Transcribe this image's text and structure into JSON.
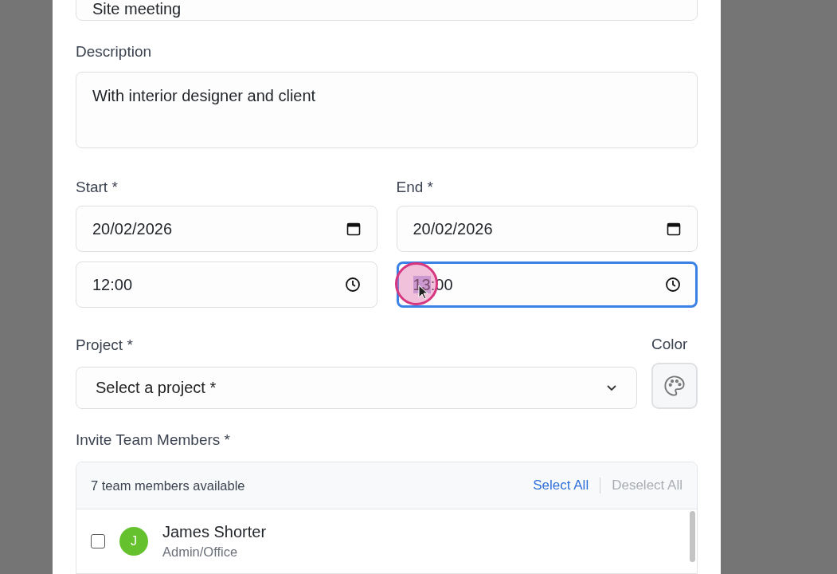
{
  "title_field": {
    "value": "Site meeting"
  },
  "description": {
    "label": "Description",
    "value": "With interior designer and client"
  },
  "start": {
    "label": "Start *",
    "date": "20/02/2026",
    "time": "12:00",
    "focused": false
  },
  "end": {
    "label": "End *",
    "date": "20/02/2026",
    "time": "13:00",
    "focused": true,
    "click_highlight": true
  },
  "project": {
    "label": "Project *",
    "placeholder": "Select a project *"
  },
  "color": {
    "label": "Color"
  },
  "invite": {
    "label": "Invite Team Members *",
    "summary": "7 team members available",
    "actions": [
      {
        "label": "Select All",
        "disabled": false
      },
      {
        "label": "Deselect All",
        "disabled": true
      }
    ],
    "members": [
      {
        "initial": "J",
        "name": "James Shorter",
        "role": "Admin/Office",
        "checked": false,
        "color": "#65c22e"
      }
    ]
  }
}
